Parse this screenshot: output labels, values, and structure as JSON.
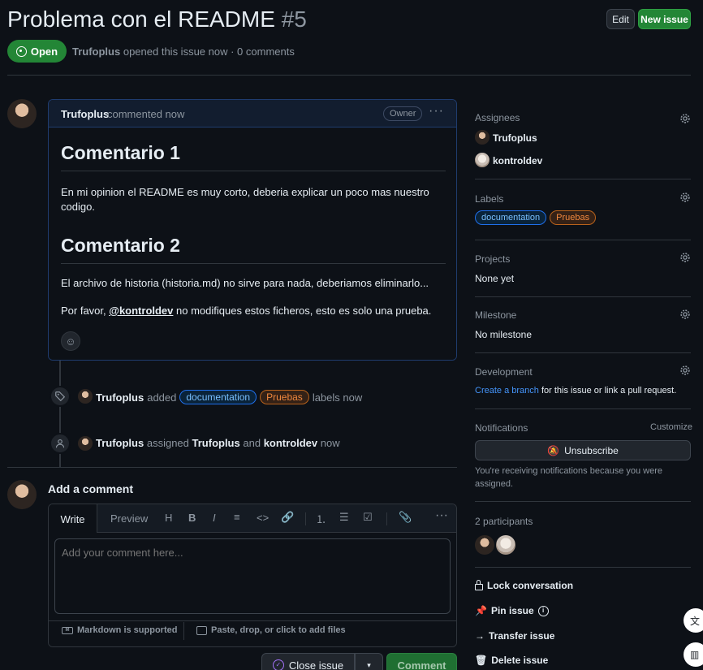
{
  "header": {
    "title": "Problema con el README",
    "number": "#5",
    "edit_label": "Edit",
    "new_issue_label": "New issue",
    "state_label": "Open",
    "author": "Trufoplus",
    "meta_text": "opened this issue now · 0 comments"
  },
  "comment": {
    "author": "Trufoplus",
    "time_text": "commented now",
    "badge": "Owner",
    "heading1": "Comentario 1",
    "para1": "En mi opinion el README es muy corto, deberia explicar un poco mas nuestro codigo.",
    "heading2": "Comentario 2",
    "para2": "El archivo de historia (historia.md) no sirve para nada, deberiamos eliminarlo...",
    "para3_before": "Por favor,",
    "mention": "@kontroldev",
    "para3_after": "no modifiques estos ficheros, esto es solo una prueba."
  },
  "timeline": {
    "event1_actor": "Trufoplus",
    "event1_verb": "added",
    "event1_suffix": "labels now",
    "event2_actor": "Trufoplus",
    "event2_verb": "assigned",
    "event2_user1": "Trufoplus",
    "event2_and": "and",
    "event2_user2": "kontroldev",
    "event2_suffix": "now"
  },
  "add_comment": {
    "title": "Add a comment",
    "tab_write": "Write",
    "tab_preview": "Preview",
    "placeholder": "Add your comment here...",
    "markdown_note": "Markdown is supported",
    "attach_note": "Paste, drop, or click to add files",
    "close_issue_label": "Close issue",
    "comment_label": "Comment"
  },
  "sidebar": {
    "assignees_title": "Assignees",
    "assignees": [
      "Trufoplus",
      "kontroldev"
    ],
    "labels_title": "Labels",
    "labels": [
      "documentation",
      "Pruebas"
    ],
    "projects_title": "Projects",
    "projects_value": "None yet",
    "milestone_title": "Milestone",
    "milestone_value": "No milestone",
    "development_title": "Development",
    "development_link": "Create a branch",
    "development_text": "for this issue or link a pull request.",
    "notifications_title": "Notifications",
    "customize_label": "Customize",
    "unsubscribe_label": "Unsubscribe",
    "notifications_note": "You're receiving notifications because you were assigned.",
    "participants_title": "2 participants",
    "lock_label": "Lock conversation",
    "pin_label": "Pin issue",
    "transfer_label": "Transfer issue",
    "delete_label": "Delete issue"
  },
  "colors": {
    "background": "#0d1117",
    "open_green": "#238636",
    "accent_blue": "#4493f8",
    "border": "#30363d"
  }
}
